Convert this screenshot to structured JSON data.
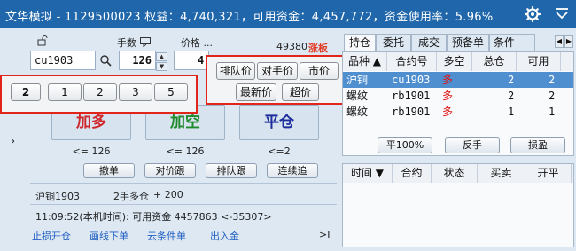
{
  "title_bar": {
    "text": "文华模拟 - 1129500023  权益：4,740,321，可用资金：4,457,772，资金使用率：5.96%"
  },
  "order": {
    "qty_label": "手数",
    "price_label": "价格 ...",
    "contract": "cu1903",
    "qty": "126",
    "price_partial": "4",
    "ref_price": "49380",
    "limit_up": "涨板"
  },
  "qty_popup": {
    "options": [
      "2",
      "1",
      "2",
      "3",
      "5"
    ]
  },
  "price_popup": {
    "row1": [
      "排队价",
      "对手价",
      "市价"
    ],
    "row2": [
      "最新价",
      "超价"
    ]
  },
  "actions": {
    "buy": {
      "label": "加多",
      "limit": "<= 126"
    },
    "sell": {
      "label": "加空",
      "limit": "<= 126"
    },
    "close": {
      "label": "平仓",
      "limit": "<=2"
    }
  },
  "small_buttons": [
    "撤单",
    "对价跟",
    "排队跟",
    "连续追"
  ],
  "position_summary": {
    "name": "沪铜1903",
    "position": "2手多仓",
    "pnl": "+ 200"
  },
  "status_line": "11:09:52(本机时间): 可用资金 4457863  <-35307>",
  "bottom_links": [
    "止损开仓",
    "画线下单",
    "云条件单",
    "出入金"
  ],
  "bottom_arrow": ">I",
  "tabs": [
    "持仓",
    "委托",
    "成交",
    "预备单",
    "条件"
  ],
  "positions": {
    "headers": [
      "品种 ▲",
      "合约号",
      "多空",
      "总仓",
      "可用"
    ],
    "rows": [
      {
        "name": "沪铜",
        "code": "cu1903",
        "dir": "多",
        "total": "2",
        "avail": "2"
      },
      {
        "name": "螺纹",
        "code": "rb1901",
        "dir": "多",
        "total": "2",
        "avail": "2"
      },
      {
        "name": "螺纹",
        "code": "rb1901",
        "dir": "多",
        "total": "1",
        "avail": "1"
      }
    ]
  },
  "position_buttons": [
    "平100%",
    "反手",
    "损盈"
  ],
  "orders": {
    "headers": [
      "时间 ▼",
      "合约",
      "状态",
      "买卖",
      "开平"
    ]
  },
  "colors": {
    "title_bg": "#1f66aa",
    "buy": "#d0262a",
    "sell": "#1f8a2b",
    "close": "#1d2d9c",
    "highlight": "#e1251b",
    "selected_row": "#4f8fd0"
  }
}
